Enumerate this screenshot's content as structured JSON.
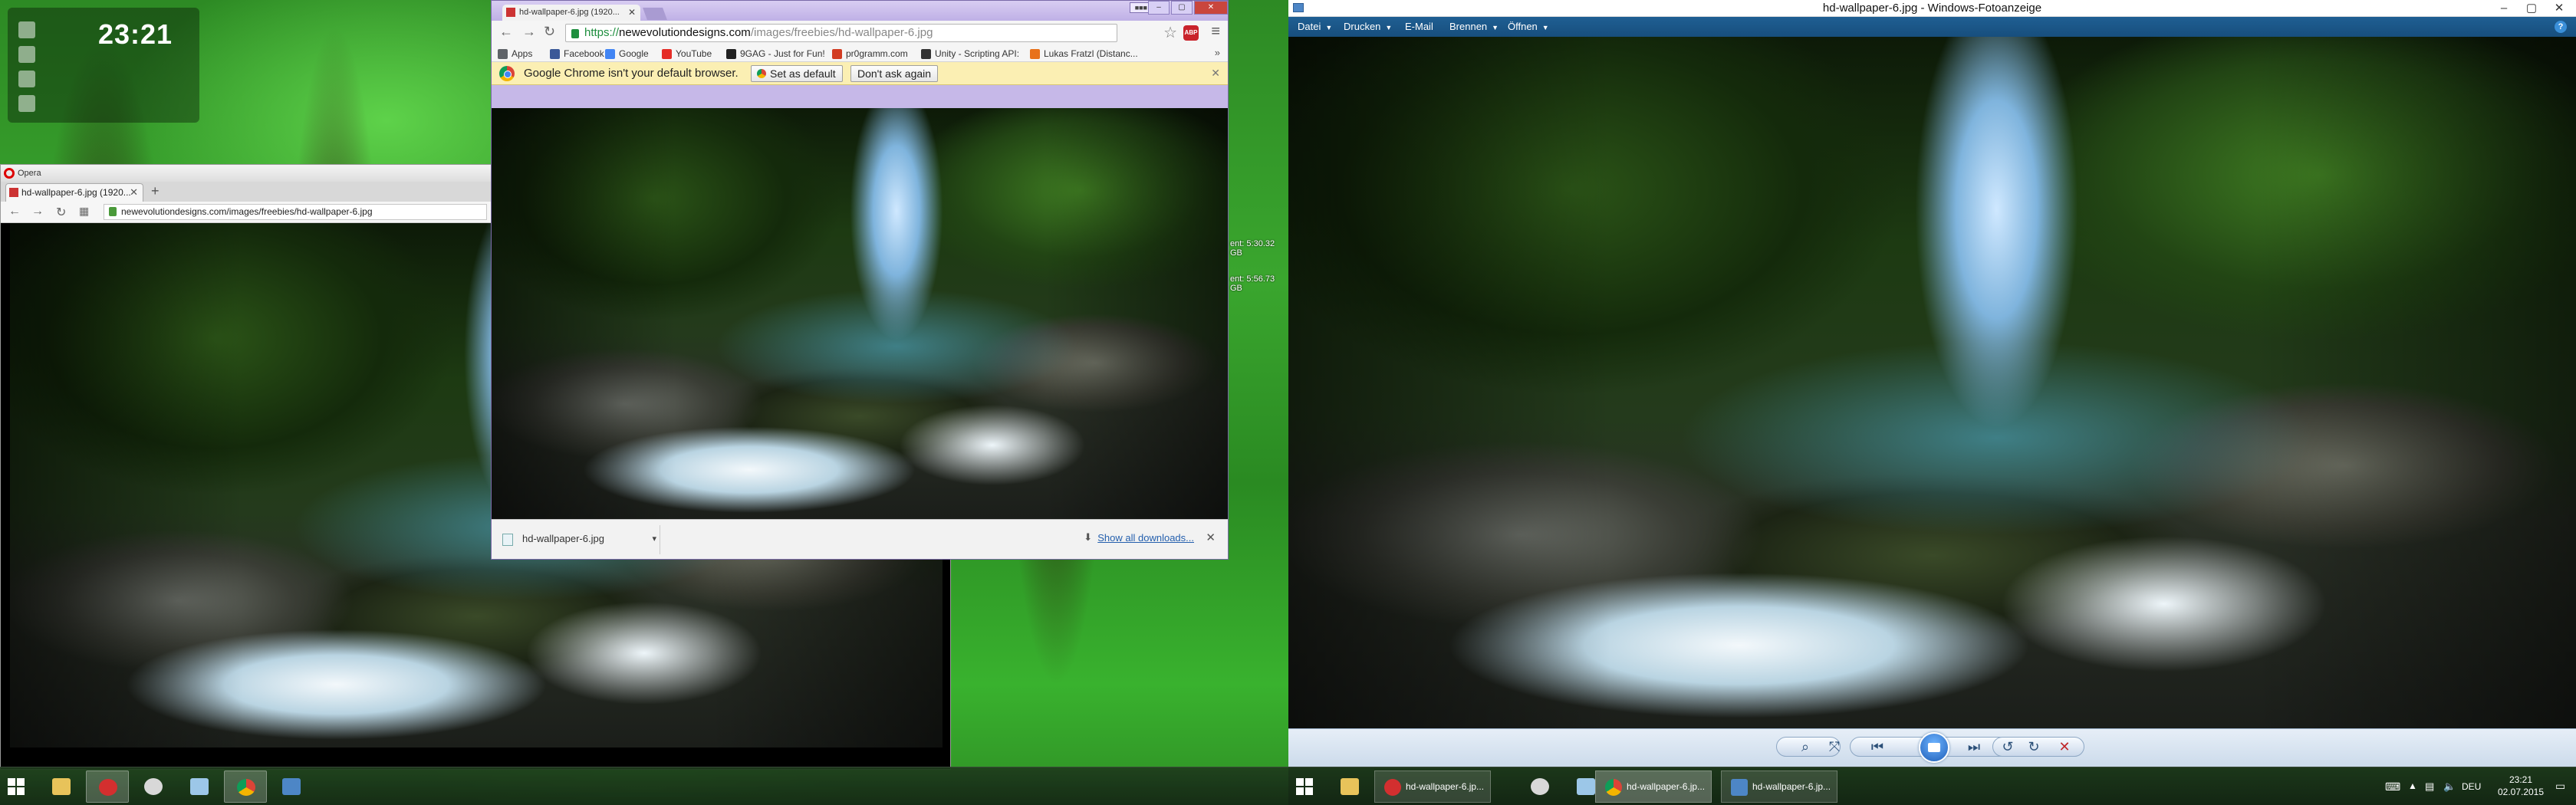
{
  "desktop": {
    "clock_time": "23:21",
    "net_labels": [
      "ent: 5:30.32 GB",
      "ent: 5:56.73 GB"
    ]
  },
  "opera": {
    "app_name": "Opera",
    "tab_title": "hd-wallpaper-6.jpg (1920...",
    "url": "newevolutiondesigns.com/images/freebies/hd-wallpaper-6.jpg"
  },
  "chrome": {
    "tab_title": "hd-wallpaper-6.jpg (1920...",
    "url_scheme": "https://",
    "url_host": "newevolutiondesigns.com",
    "url_path": "/images/freebies/hd-wallpaper-6.jpg",
    "bookmarks": [
      {
        "label": "Apps",
        "color": "#5f6368"
      },
      {
        "label": "Facebook",
        "color": "#3b5998"
      },
      {
        "label": "Google",
        "color": "#4285f4"
      },
      {
        "label": "YouTube",
        "color": "#e52d27"
      },
      {
        "label": "9GAG - Just for Fun!",
        "color": "#222222"
      },
      {
        "label": "pr0gramm.com",
        "color": "#d23c22"
      },
      {
        "label": "Unity - Scripting API:",
        "color": "#333333"
      },
      {
        "label": "Lukas Fratzl (Distanc...",
        "color": "#e8711a"
      }
    ],
    "infobar_message": "Google Chrome isn't your default browser.",
    "set_default_label": "Set as default",
    "dont_ask_label": "Don't ask again",
    "download_file": "hd-wallpaper-6.jpg",
    "show_all_downloads": "Show all downloads..."
  },
  "photo_viewer": {
    "title": "hd-wallpaper-6.jpg - Windows-Fotoanzeige",
    "menu": [
      "Datei",
      "Drucken",
      "E-Mail",
      "Brennen",
      "Öffnen"
    ]
  },
  "taskbar_left": {
    "tasks": [
      "hd-wallpaper-6.jp...",
      "hd-wallpaper-6.jp...",
      "hd-wallpaper-6.jp..."
    ]
  },
  "tray": {
    "language": "DEU",
    "time": "23:21",
    "date": "02.07.2015"
  },
  "colors": {
    "accent_blue": "#1f5f93",
    "infobar_yellow": "#fbefb3",
    "chrome_frame": "#c6b8e8"
  }
}
